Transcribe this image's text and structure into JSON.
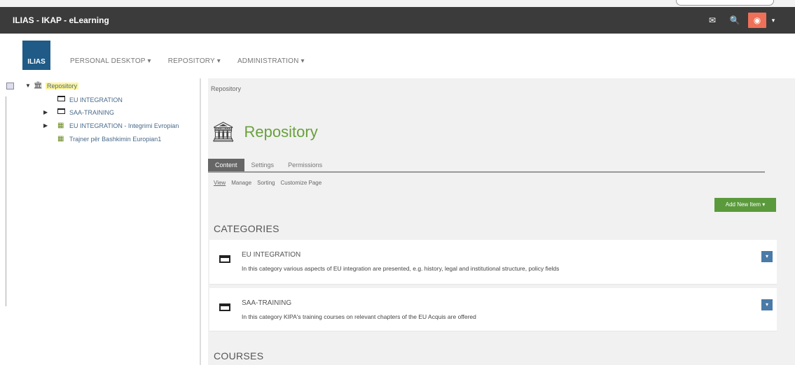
{
  "app": {
    "title": "ILIAS - IKAP - eLearning"
  },
  "topbar": {
    "icons": [
      "mail-icon",
      "search-icon",
      "user-icon",
      "caret-down-icon"
    ],
    "user_accent": "#ee7058"
  },
  "logo": {
    "text": "ILIAS"
  },
  "mainnav": [
    {
      "label": "PERSONAL DESKTOP ▾"
    },
    {
      "label": "REPOSITORY ▾"
    },
    {
      "label": "ADMINISTRATION ▾"
    }
  ],
  "tree": {
    "root": "Repository",
    "items": [
      {
        "label": "EU INTEGRATION",
        "type": "category"
      },
      {
        "label": "SAA-TRAINING",
        "type": "category"
      },
      {
        "label": "EU INTEGRATION - Integrimi Evropian",
        "type": "course"
      },
      {
        "label": "Trajner për Bashkimin Europian1",
        "type": "course"
      }
    ]
  },
  "content": {
    "breadcrumb": "Repository",
    "title": "Repository",
    "title_color": "#6aa03c",
    "tabs": [
      {
        "label": "Content",
        "active": true
      },
      {
        "label": "Settings"
      },
      {
        "label": "Permissions"
      }
    ],
    "subtabs": [
      {
        "label": "View",
        "active": true
      },
      {
        "label": "Manage"
      },
      {
        "label": "Sorting"
      },
      {
        "label": "Customize Page"
      }
    ],
    "add_button": "Add New Item ▾",
    "add_button_color": "#5a9a3c",
    "sections": {
      "categories": "CATEGORIES",
      "courses": "COURSES"
    },
    "cards": [
      {
        "title": "EU INTEGRATION",
        "desc": "In this category various aspects of EU integration are presented, e.g. history, legal and institutional structure, policy fields"
      },
      {
        "title": "SAA-TRAINING",
        "desc": "In this category KIPA's training courses on relevant chapters of the EU Acquis are offered"
      }
    ]
  }
}
